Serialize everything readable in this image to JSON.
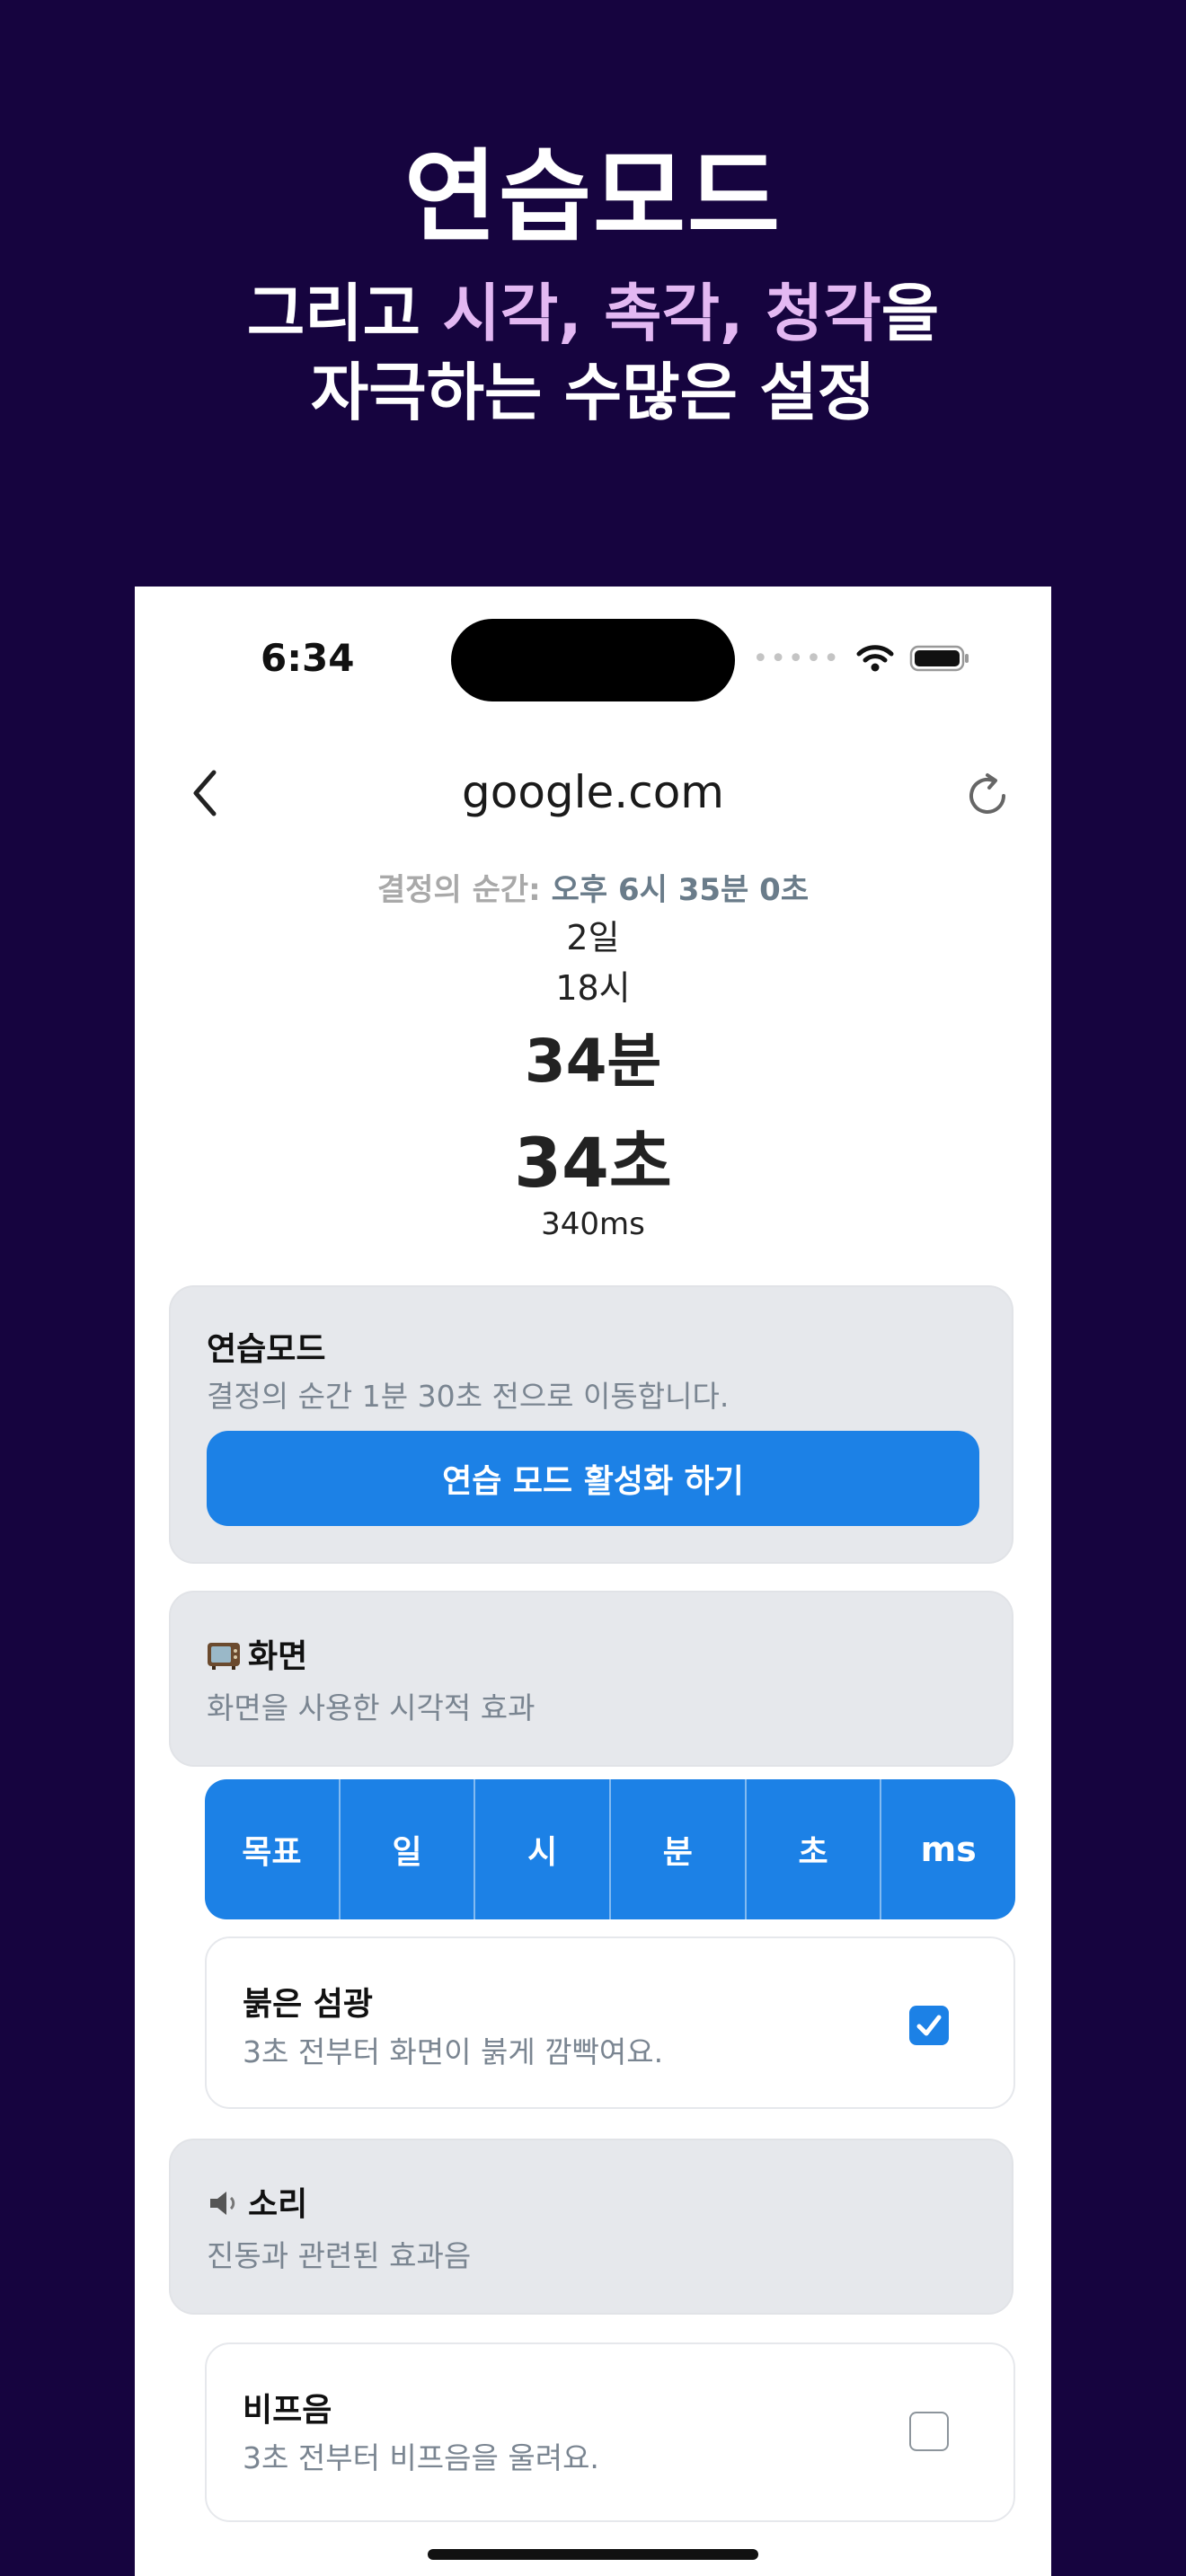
{
  "hero": {
    "title": "연습모드",
    "line1_prefix": "그리고 ",
    "line1_highlight": "시각, 촉각, 청각",
    "line1_suffix": "을",
    "line2": "자극하는 수많은 설정"
  },
  "status": {
    "time": "6:34",
    "signal_dots": "•••••"
  },
  "nav": {
    "title": "google.com"
  },
  "moment": {
    "label": "결정의 순간: ",
    "value": "오후 6시 35분 0초"
  },
  "countdown": {
    "days": "2일",
    "hours": "18시",
    "minutes": "34분",
    "seconds": "34초",
    "ms": "340ms"
  },
  "practice": {
    "title": "연습모드",
    "description": "결정의 순간 1분 30초 전으로 이동합니다.",
    "button_label": "연습 모드 활성화 하기"
  },
  "screen_section": {
    "title": "화면",
    "description": "화면을 사용한 시각적 효과",
    "icon": "tv-icon"
  },
  "unit_tabs": [
    "목표",
    "일",
    "시",
    "분",
    "초",
    "ms"
  ],
  "red_flash": {
    "title": "붉은 섬광",
    "description": "3초 전부터 화면이 붉게 깜빡여요.",
    "checked": true
  },
  "sound_section": {
    "title": "소리",
    "description": "진동과 관련된 효과음",
    "icon": "speaker-icon"
  },
  "beep": {
    "title": "비프음",
    "description": "3초 전부터 비프음을 울려요.",
    "checked": false
  },
  "colors": {
    "background": "#16043f",
    "accent": "#1c81e6",
    "highlight": "#e3b8f2"
  }
}
